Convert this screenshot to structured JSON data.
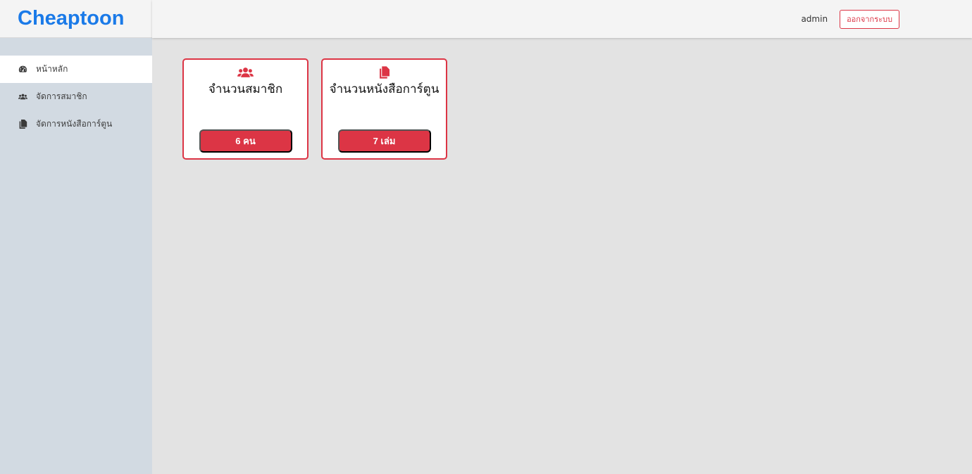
{
  "brand": {
    "name": "Cheaptoon",
    "color": "#1a7ae8"
  },
  "header": {
    "username": "admin",
    "logout_label": "ออกจากระบบ"
  },
  "sidebar": {
    "items": [
      {
        "label": "หน้าหลัก",
        "icon": "dashboard-icon",
        "active": true
      },
      {
        "label": "จัดการสมาชิก",
        "icon": "users-icon",
        "active": false
      },
      {
        "label": "จัดการหนังสือการ์ตูน",
        "icon": "copy-icon",
        "active": false
      }
    ]
  },
  "cards": [
    {
      "title": "จำนวนสมาชิก",
      "icon": "users-icon",
      "value": "6 คน"
    },
    {
      "title": "จำนวนหนังสือการ์ตูน",
      "icon": "file-copy-icon",
      "value": "7 เล่ม"
    }
  ],
  "colors": {
    "accent": "#dc3545",
    "sidebar_bg": "#d2dae2",
    "content_bg": "#e3e3e3"
  }
}
